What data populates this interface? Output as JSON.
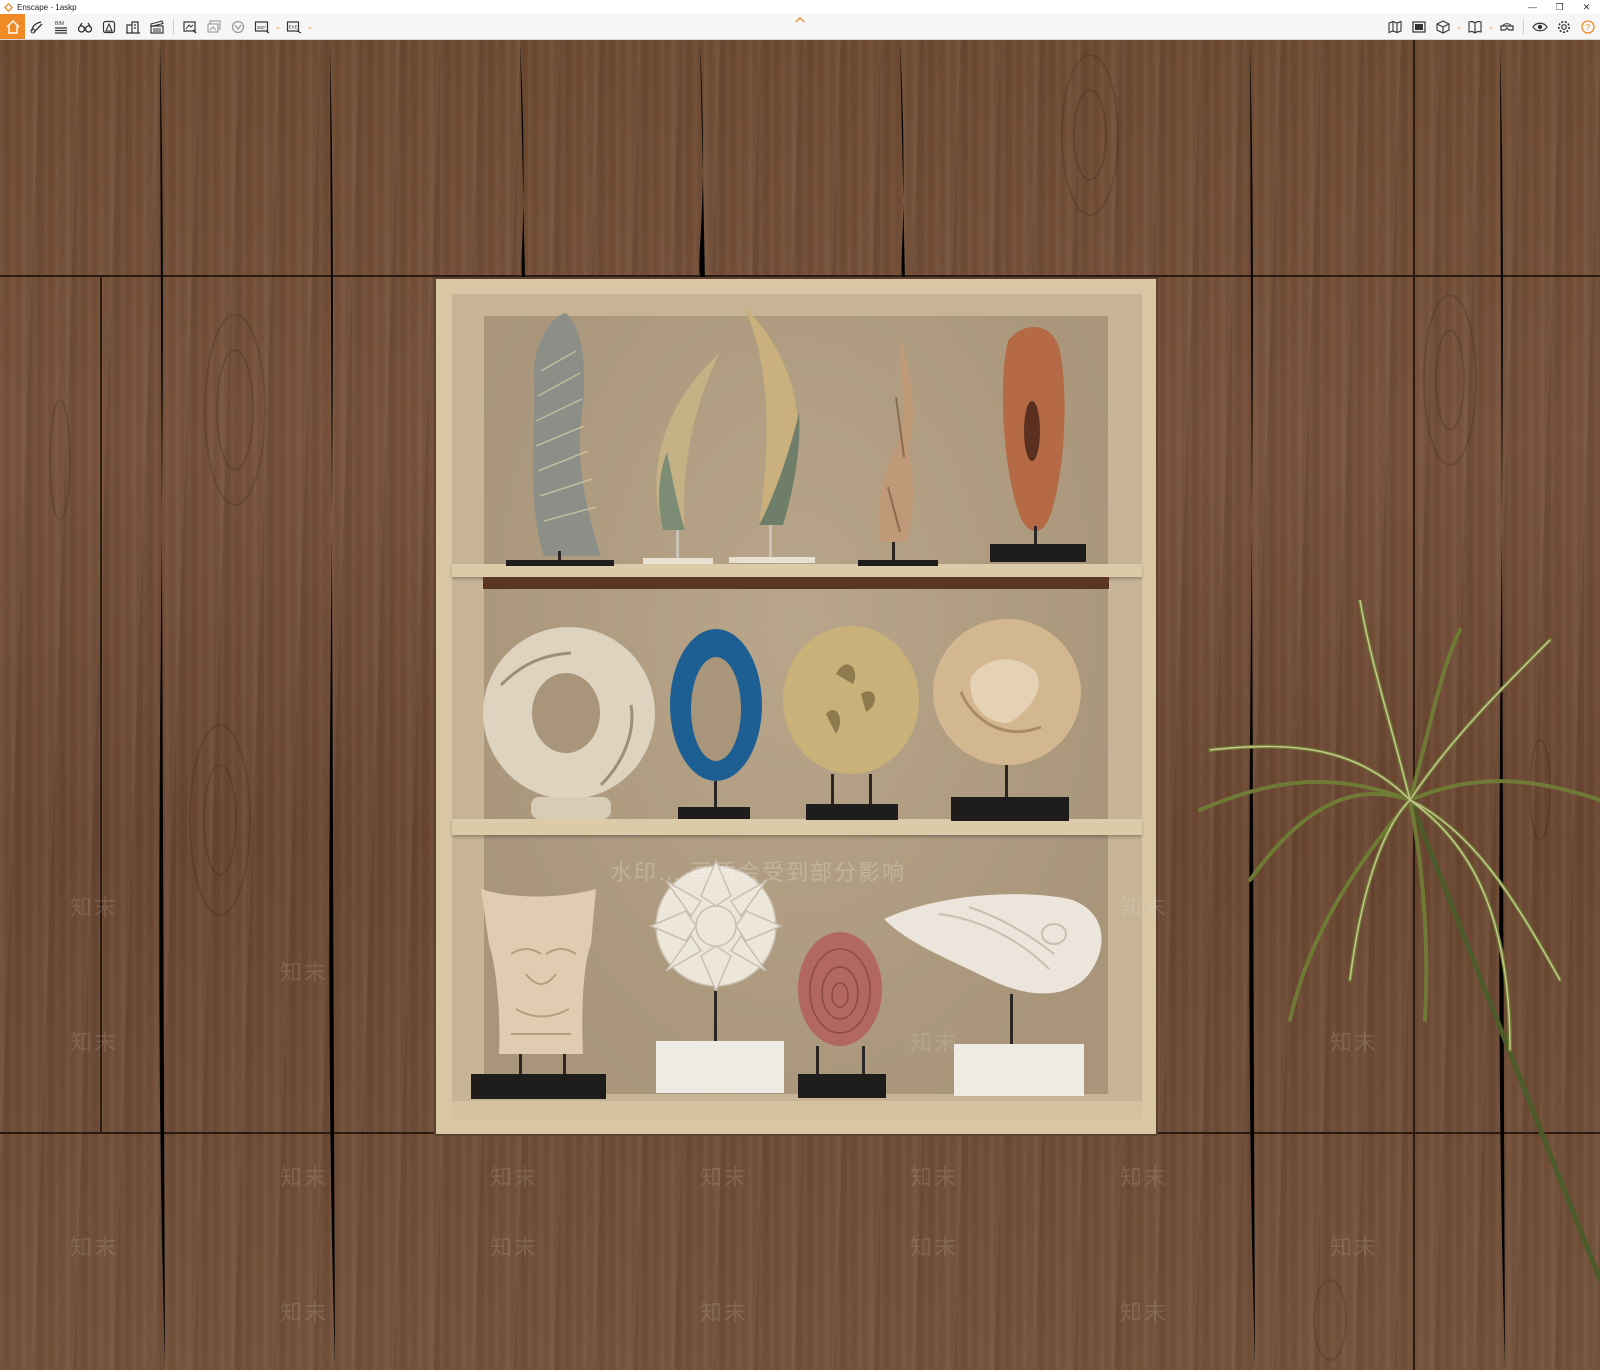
{
  "window": {
    "title": "Enscape - 1askp",
    "controls": [
      "—",
      "❐",
      "✕"
    ]
  },
  "toolbar": {
    "left_buttons": [
      {
        "name": "home-button",
        "icon": "home-icon"
      },
      {
        "name": "assets-button",
        "icon": "asset-library-icon"
      },
      {
        "name": "bim-button",
        "icon": "bim-icon",
        "label": "BIM"
      },
      {
        "name": "binoculars-button",
        "icon": "binoculars-icon"
      },
      {
        "name": "atmosphere-button",
        "icon": "atmosphere-icon"
      },
      {
        "name": "buildings-button",
        "icon": "buildings-icon"
      },
      {
        "name": "clapper-button",
        "icon": "clapperboard-icon"
      },
      {
        "name": "screenshot-button",
        "icon": "screenshot-icon"
      },
      {
        "name": "batch-render-button",
        "icon": "batch-render-icon"
      },
      {
        "name": "vr-button",
        "icon": "vr-icon"
      },
      {
        "name": "panorama-button",
        "icon": "panorama-icon",
        "label": "360°"
      },
      {
        "name": "export-button",
        "icon": "export-icon",
        "label": "EXE"
      }
    ],
    "right_buttons": [
      {
        "name": "map-button",
        "icon": "map-icon"
      },
      {
        "name": "views-button",
        "icon": "views-icon"
      },
      {
        "name": "cube-button",
        "icon": "cube-icon"
      },
      {
        "name": "book-button",
        "icon": "book-icon"
      },
      {
        "name": "headset-button",
        "icon": "headset-icon"
      },
      {
        "name": "visibility-button",
        "icon": "eye-icon"
      },
      {
        "name": "settings-button",
        "icon": "gear-icon"
      },
      {
        "name": "help-button",
        "icon": "help-icon",
        "label": "?"
      }
    ]
  },
  "colors": {
    "accent": "#f08a24",
    "wood": "#6e4a31",
    "niche": "#d8c6a4"
  },
  "watermark": {
    "line": "水印… 画质会受到部分影响",
    "tile": "知末"
  }
}
